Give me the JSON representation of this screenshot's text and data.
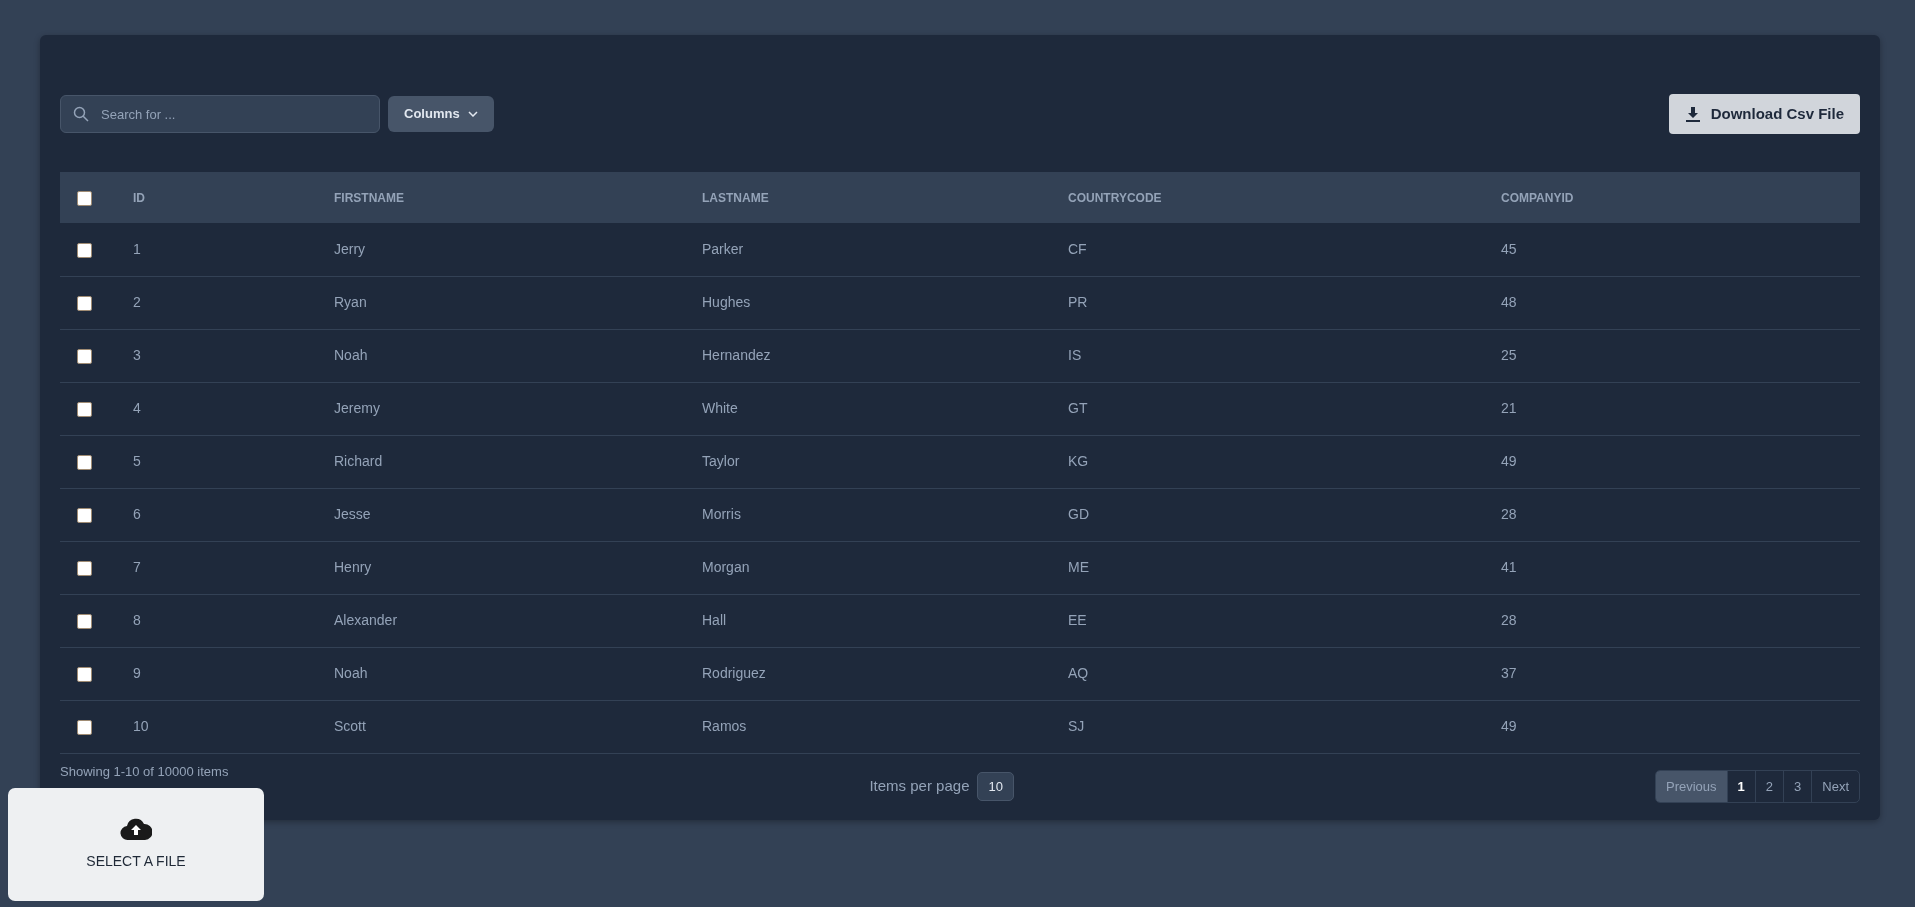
{
  "toolbar": {
    "search": {
      "placeholder": "Search for ..."
    },
    "columns_button": "Columns",
    "download_button": "Download Csv File"
  },
  "table": {
    "select_all": {
      "checked": false
    },
    "columns": [
      "ID",
      "FIRSTNAME",
      "LASTNAME",
      "COUNTRYCODE",
      "COMPANYID"
    ],
    "rows": [
      {
        "checked": false,
        "cells": [
          "1",
          "Jerry",
          "Parker",
          "CF",
          "45"
        ]
      },
      {
        "checked": false,
        "cells": [
          "2",
          "Ryan",
          "Hughes",
          "PR",
          "48"
        ]
      },
      {
        "checked": false,
        "cells": [
          "3",
          "Noah",
          "Hernandez",
          "IS",
          "25"
        ]
      },
      {
        "checked": false,
        "cells": [
          "4",
          "Jeremy",
          "White",
          "GT",
          "21"
        ]
      },
      {
        "checked": false,
        "cells": [
          "5",
          "Richard",
          "Taylor",
          "KG",
          "49"
        ]
      },
      {
        "checked": false,
        "cells": [
          "6",
          "Jesse",
          "Morris",
          "GD",
          "28"
        ]
      },
      {
        "checked": false,
        "cells": [
          "7",
          "Henry",
          "Morgan",
          "ME",
          "41"
        ]
      },
      {
        "checked": false,
        "cells": [
          "8",
          "Alexander",
          "Hall",
          "EE",
          "28"
        ]
      },
      {
        "checked": false,
        "cells": [
          "9",
          "Noah",
          "Rodriguez",
          "AQ",
          "37"
        ]
      },
      {
        "checked": false,
        "cells": [
          "10",
          "Scott",
          "Ramos",
          "SJ",
          "49"
        ]
      }
    ]
  },
  "footer": {
    "summary": "Showing 1-10 of 10000 items",
    "items_per_page_label": "Items per page",
    "items_per_page": "10",
    "pagination": {
      "previous": {
        "label": "Previous",
        "disabled": true
      },
      "pages": [
        {
          "label": "1",
          "selected": true
        },
        {
          "label": "2",
          "selected": false
        },
        {
          "label": "3",
          "selected": false
        }
      ],
      "next": {
        "label": "Next",
        "disabled": false
      }
    }
  },
  "upload": {
    "label": "SELECT A FILE"
  }
}
